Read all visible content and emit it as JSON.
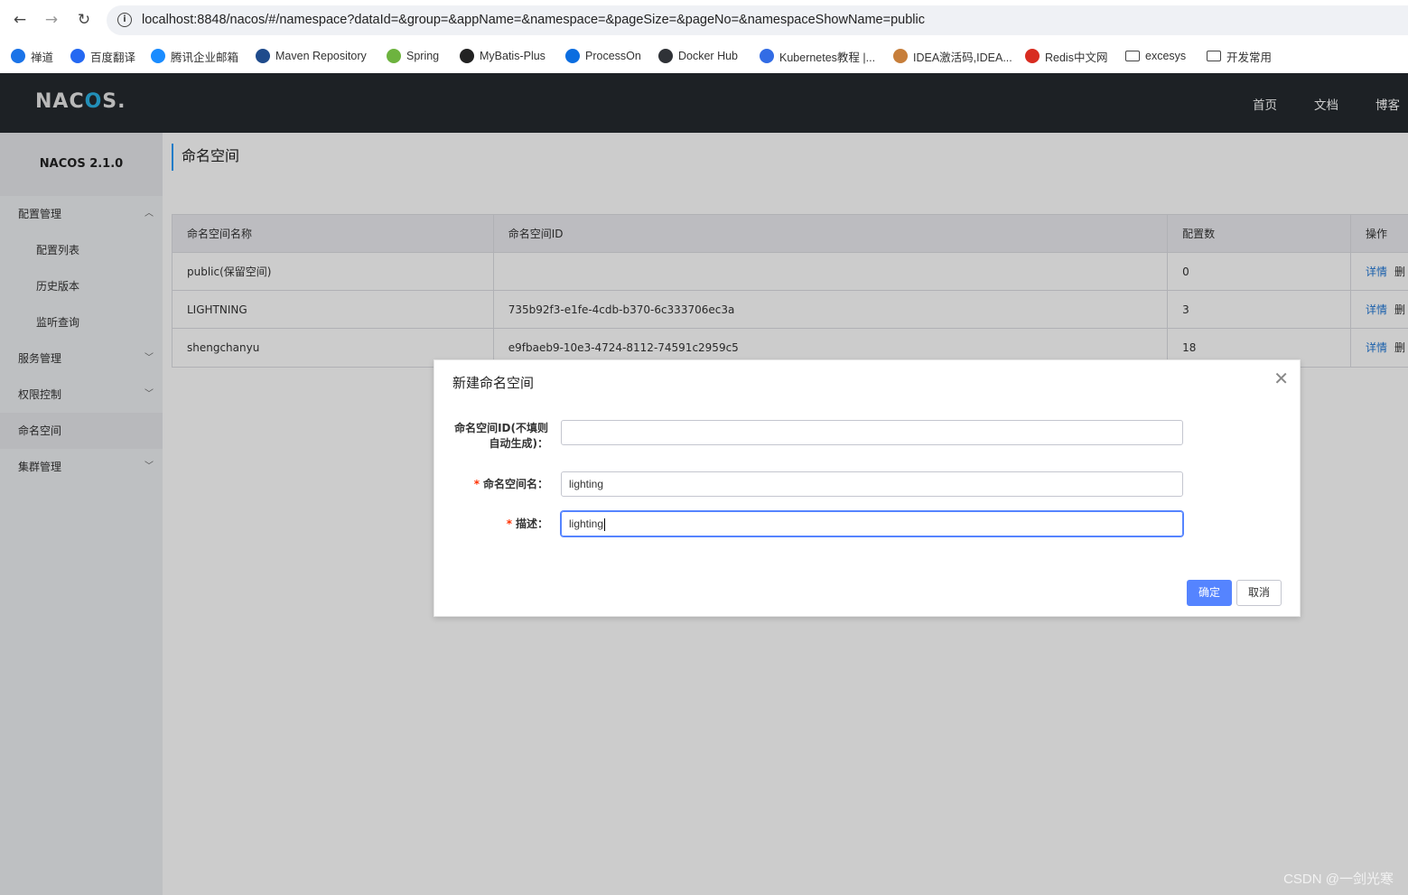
{
  "browser": {
    "url": "localhost:8848/nacos/#/namespace?dataId=&group=&appName=&namespace=&pageSize=&pageNo=&namespaceShowName=public",
    "bookmarks": [
      {
        "label": "禅道",
        "icon": "zentao-icon",
        "color": "#1a73e8"
      },
      {
        "label": "百度翻译",
        "icon": "baidu-translate-icon",
        "color": "#2468f2"
      },
      {
        "label": "腾讯企业邮箱",
        "icon": "tencent-mail-icon",
        "color": "#1a8cff"
      },
      {
        "label": "Maven Repository",
        "icon": "maven-icon",
        "color": "#1f4b8c"
      },
      {
        "label": "Spring",
        "icon": "spring-icon",
        "color": "#6db33f"
      },
      {
        "label": "MyBatis-Plus",
        "icon": "mybatis-icon",
        "color": "#222222"
      },
      {
        "label": "ProcessOn",
        "icon": "processon-icon",
        "color": "#0b6de0"
      },
      {
        "label": "Docker Hub",
        "icon": "docker-icon",
        "color": "#2f3237"
      },
      {
        "label": "Kubernetes教程 |...",
        "icon": "kubernetes-icon",
        "color": "#326ce5"
      },
      {
        "label": "IDEA激活码,IDEA...",
        "icon": "idea-icon",
        "color": "#c77e3a"
      },
      {
        "label": "Redis中文网",
        "icon": "redis-icon",
        "color": "#d82c20"
      },
      {
        "label": "excesys",
        "icon": "folder-icon",
        "color": "#444444"
      },
      {
        "label": "开发常用",
        "icon": "folder-icon",
        "color": "#444444"
      }
    ]
  },
  "header": {
    "logo": "NACOS.",
    "nav": [
      "首页",
      "文档",
      "博客"
    ]
  },
  "sidebar": {
    "version": "NACOS 2.1.0",
    "items": [
      {
        "label": "配置管理",
        "chevron": "^"
      },
      {
        "label": "配置列表"
      },
      {
        "label": "历史版本"
      },
      {
        "label": "监听查询"
      },
      {
        "label": "服务管理",
        "chevron": "v"
      },
      {
        "label": "权限控制",
        "chevron": "v"
      },
      {
        "label": "命名空间"
      },
      {
        "label": "集群管理",
        "chevron": "v"
      }
    ]
  },
  "page": {
    "title": "命名空间",
    "table": {
      "headers": [
        "命名空间名称",
        "命名空间ID",
        "配置数",
        "操作"
      ],
      "rows": [
        {
          "name": "public(保留空间)",
          "id": "",
          "count": "0",
          "detail": "详情",
          "delete": "删"
        },
        {
          "name": "LIGHTNING",
          "id": "735b92f3-e1fe-4cdb-b370-6c333706ec3a",
          "count": "3",
          "detail": "详情",
          "delete": "删"
        },
        {
          "name": "shengchanyu",
          "id": "e9fbaeb9-10e3-4724-8112-74591c2959c5",
          "count": "18",
          "detail": "详情",
          "delete": "删"
        }
      ]
    }
  },
  "dialog": {
    "title": "新建命名空间",
    "close": "✕",
    "fields": {
      "id_label_line1": "命名空间ID(不填则",
      "id_label_line2": "自动生成)：",
      "id_value": "",
      "name_label": "命名空间名：",
      "name_value": "lighting",
      "desc_label": "描述：",
      "desc_value": "lighting",
      "required_mark": "*"
    },
    "confirm": "确定",
    "cancel": "取消"
  },
  "watermark": "CSDN @一剑光寒"
}
